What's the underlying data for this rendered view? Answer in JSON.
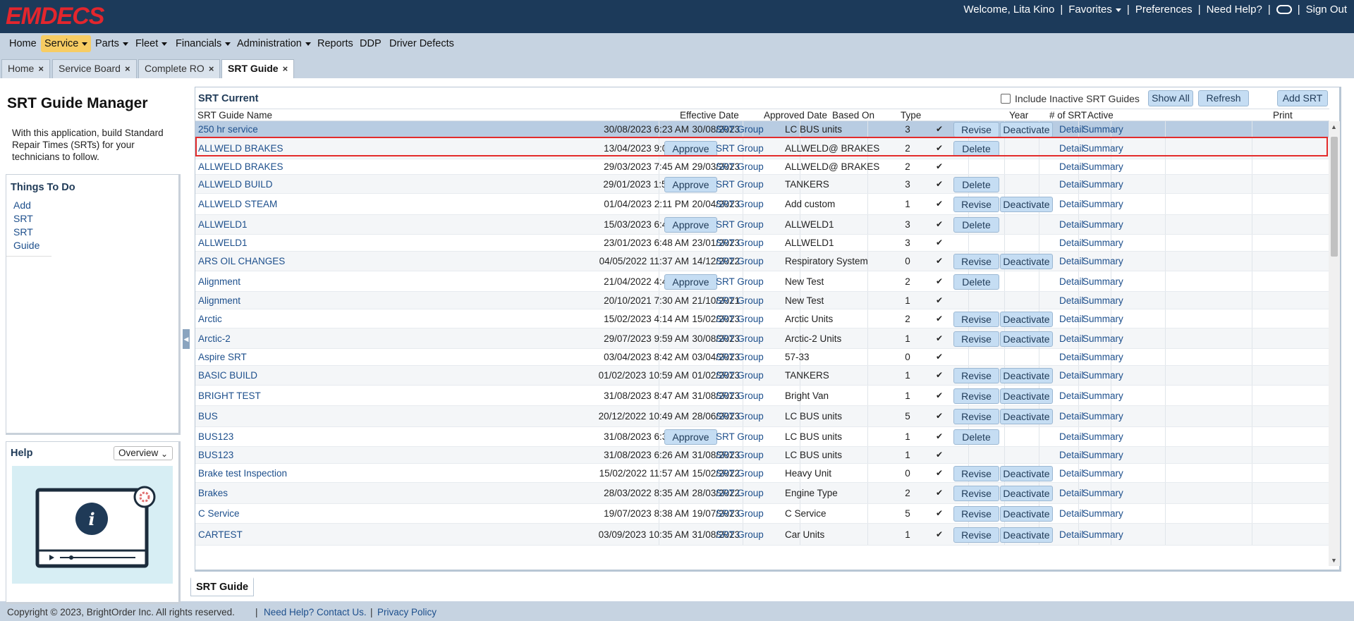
{
  "header": {
    "logo": "EMDECS",
    "welcome": "Welcome, Lita Kino",
    "favorites": "Favorites",
    "preferences": "Preferences",
    "need_help": "Need Help?",
    "sign_out": "Sign Out",
    "separator": "|"
  },
  "menu": [
    "Home",
    "Service",
    "Parts",
    "Fleet",
    "Financials",
    "Administration",
    "Reports",
    "DDP",
    "Driver Defects"
  ],
  "tabs": [
    "Home",
    "Service Board",
    "Complete RO",
    "SRT Guide"
  ],
  "tab_close": "×",
  "left": {
    "title": "SRT Guide Manager",
    "intro": "With this application, build Standard Repair Times (SRTs) for your technicians to follow.",
    "todo_title": "Things To Do",
    "todo_links": [
      "Add SRT",
      "SRT Guide"
    ],
    "help_title": "Help",
    "help_select": "Overview",
    "help_icon_letter": "i"
  },
  "grid": {
    "title": "SRT Current",
    "include_inactive": "Include Inactive SRT Guides",
    "show_all": "Show All",
    "refresh": "Refresh",
    "add_srt": "Add SRT",
    "columns": {
      "name": "SRT Guide Name",
      "effective": "Effective Date",
      "approved": "Approved Date",
      "based_on": "Based On",
      "type": "Type",
      "year": "Year",
      "num_srt": "# of SRT",
      "active": "Active",
      "print": "Print"
    },
    "labels": {
      "approve": "Approve",
      "revise": "Revise",
      "delete": "Delete",
      "deactivate": "Deactivate",
      "detail": "Detail",
      "summary": "Summary",
      "check": "✔"
    },
    "rows": [
      {
        "name": "250 hr service",
        "eff": "30/08/2023 6:23 AM",
        "appr": "30/08/2023",
        "based": "SRT Group",
        "type": "LC BUS units",
        "n": "3",
        "a": "revise",
        "d": true
      },
      {
        "name": "ALLWELD BRAKES",
        "eff": "13/04/2023 9:07 AM",
        "appr": "",
        "based": "SRT Group",
        "type": "ALLWELD@ BRAKES",
        "n": "2",
        "a": "delete",
        "d": false
      },
      {
        "name": "ALLWELD BRAKES",
        "eff": "29/03/2023 7:45 AM",
        "appr": "29/03/2023",
        "based": "SRT Group",
        "type": "ALLWELD@ BRAKES",
        "n": "2",
        "a": "",
        "d": false
      },
      {
        "name": "ALLWELD BUILD",
        "eff": "29/01/2023 1:56 PM",
        "appr": "",
        "based": "SRT Group",
        "type": "TANKERS",
        "n": "3",
        "a": "delete",
        "d": false
      },
      {
        "name": "ALLWELD STEAM",
        "eff": "01/04/2023 2:11 PM",
        "appr": "20/04/2023",
        "based": "SRT Group",
        "type": "Add custom",
        "n": "1",
        "a": "revise",
        "d": true
      },
      {
        "name": "ALLWELD1",
        "eff": "15/03/2023 6:45 AM",
        "appr": "",
        "based": "SRT Group",
        "type": "ALLWELD1",
        "n": "3",
        "a": "delete",
        "d": false
      },
      {
        "name": "ALLWELD1",
        "eff": "23/01/2023 6:48 AM",
        "appr": "23/01/2023",
        "based": "SRT Group",
        "type": "ALLWELD1",
        "n": "3",
        "a": "",
        "d": false
      },
      {
        "name": "ARS OIL CHANGES",
        "eff": "04/05/2022 11:37 AM",
        "appr": "14/12/2022",
        "based": "SRT Group",
        "type": "Respiratory System",
        "n": "0",
        "a": "revise",
        "d": true
      },
      {
        "name": "Alignment",
        "eff": "21/04/2022 4:43 AM",
        "appr": "",
        "based": "SRT Group",
        "type": "New Test",
        "n": "2",
        "a": "delete",
        "d": false
      },
      {
        "name": "Alignment",
        "eff": "20/10/2021 7:30 AM",
        "appr": "21/10/2021",
        "based": "SRT Group",
        "type": "New Test",
        "n": "1",
        "a": "",
        "d": false
      },
      {
        "name": "Arctic",
        "eff": "15/02/2023 4:14 AM",
        "appr": "15/02/2023",
        "based": "SRT Group",
        "type": "Arctic Units",
        "n": "2",
        "a": "revise",
        "d": true
      },
      {
        "name": "Arctic-2",
        "eff": "29/07/2023 9:59 AM",
        "appr": "30/08/2023",
        "based": "SRT Group",
        "type": "Arctic-2 Units",
        "n": "1",
        "a": "revise",
        "d": true
      },
      {
        "name": "Aspire SRT",
        "eff": "03/04/2023 8:42 AM",
        "appr": "03/04/2023",
        "based": "SRT Group",
        "type": "57-33",
        "n": "0",
        "a": "",
        "d": false
      },
      {
        "name": "BASIC BUILD",
        "eff": "01/02/2023 10:59 AM",
        "appr": "01/02/2023",
        "based": "SRT Group",
        "type": "TANKERS",
        "n": "1",
        "a": "revise",
        "d": true
      },
      {
        "name": "BRIGHT TEST",
        "eff": "31/08/2023 8:47 AM",
        "appr": "31/08/2023",
        "based": "SRT Group",
        "type": "Bright Van",
        "n": "1",
        "a": "revise",
        "d": true
      },
      {
        "name": "BUS",
        "eff": "20/12/2022 10:49 AM",
        "appr": "28/06/2023",
        "based": "SRT Group",
        "type": "LC BUS units",
        "n": "5",
        "a": "revise",
        "d": true
      },
      {
        "name": "BUS123",
        "eff": "31/08/2023 6:32 AM",
        "appr": "",
        "based": "SRT Group",
        "type": "LC BUS units",
        "n": "1",
        "a": "delete",
        "d": false
      },
      {
        "name": "BUS123",
        "eff": "31/08/2023 6:26 AM",
        "appr": "31/08/2023",
        "based": "SRT Group",
        "type": "LC BUS units",
        "n": "1",
        "a": "",
        "d": false
      },
      {
        "name": "Brake test Inspection",
        "eff": "15/02/2022 11:57 AM",
        "appr": "15/02/2022",
        "based": "SRT Group",
        "type": "Heavy Unit",
        "n": "0",
        "a": "revise",
        "d": true
      },
      {
        "name": "Brakes",
        "eff": "28/03/2022 8:35 AM",
        "appr": "28/03/2022",
        "based": "SRT Group",
        "type": "Engine Type",
        "n": "2",
        "a": "revise",
        "d": true
      },
      {
        "name": "C Service",
        "eff": "19/07/2023 8:38 AM",
        "appr": "19/07/2023",
        "based": "SRT Group",
        "type": "C Service",
        "n": "5",
        "a": "revise",
        "d": true
      },
      {
        "name": "CARTEST",
        "eff": "03/09/2023 10:35 AM",
        "appr": "31/08/2023",
        "based": "SRT Group",
        "type": "Car Units",
        "n": "1",
        "a": "revise",
        "d": true
      }
    ]
  },
  "bottom_tab": "SRT Guide",
  "footer": {
    "copyright": "Copyright © 2023, BrightOrder Inc. All rights reserved.",
    "sep": "|",
    "contact": "Need Help? Contact Us.",
    "privacy": "Privacy Policy"
  }
}
